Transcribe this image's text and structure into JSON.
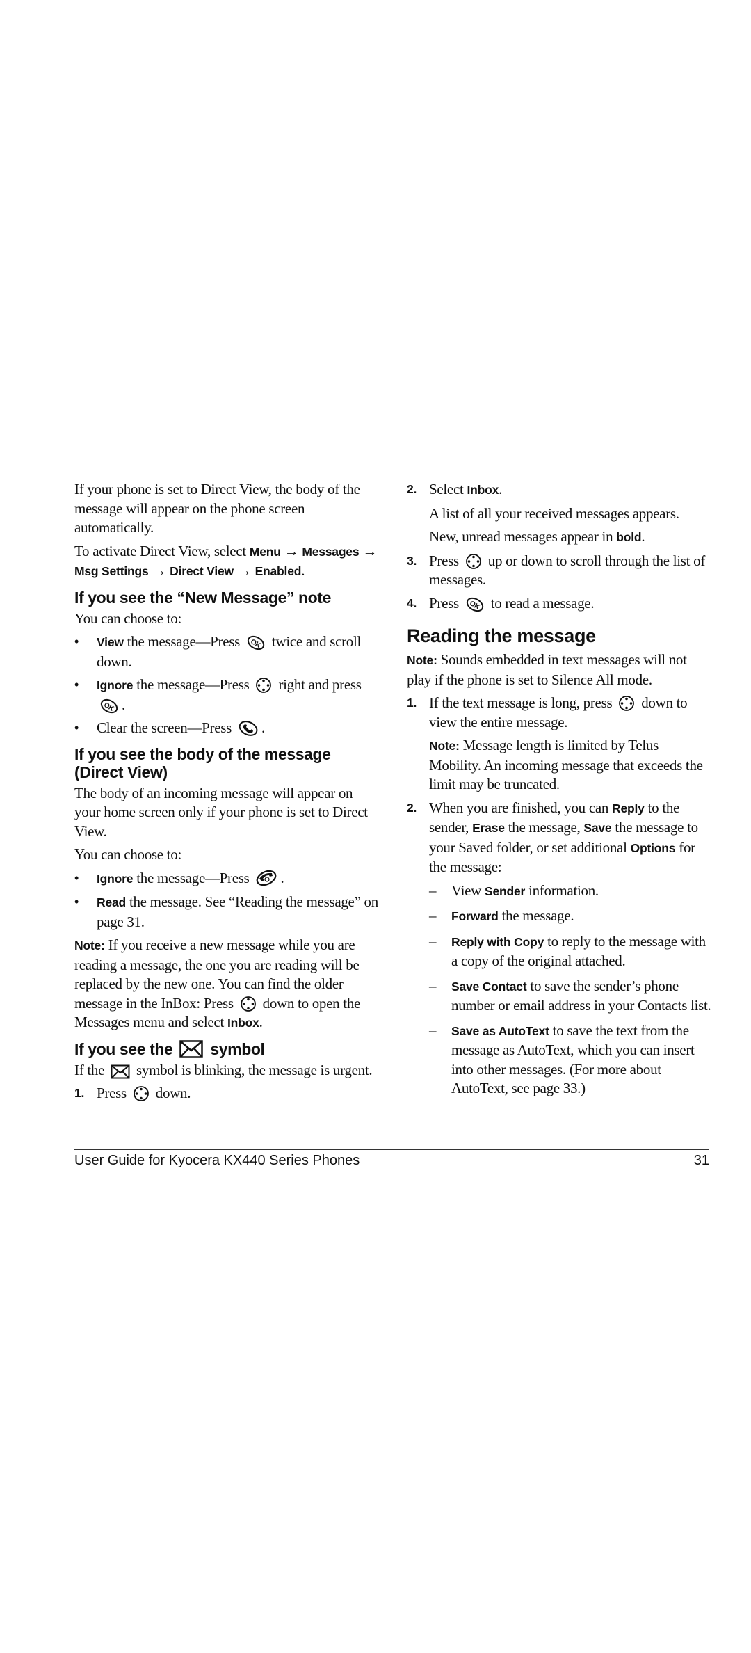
{
  "left": {
    "intro_p1": "If your phone is set to Direct View, the body of the message will appear on the phone screen automatically.",
    "intro_p2_prefix": "To activate Direct View, select",
    "intro_path": [
      "Menu",
      "Messages",
      "Msg Settings",
      "Direct View",
      "Enabled"
    ],
    "arrow": "→",
    "section1": {
      "heading": "If you see the “New Message” note",
      "lead": "You can choose to:",
      "bullets": [
        {
          "bold": "View",
          "text_before_icon": " the message—Press",
          "icon": "ok-key",
          "text_after_icon": "twice and scroll down."
        },
        {
          "bold": "Ignore",
          "text_before_icon": " the message—Press",
          "icon": "nav-key",
          "text_mid": "right and press",
          "icon2": "ok-key",
          "text_after_icon": "."
        },
        {
          "bold": "",
          "text_before_icon": "Clear the screen—Press",
          "icon": "send-key",
          "text_after_icon": "."
        }
      ]
    },
    "section2": {
      "heading": "If you see the body of the message (Direct View)",
      "body": "The body of an incoming message will appear on your home screen only if your phone is set to Direct View.",
      "lead": "You can choose to:",
      "bullets": [
        {
          "bold": "Ignore",
          "text_before_icon": " the message—Press",
          "icon": "end-key",
          "text_after_icon": "."
        },
        {
          "bold": "Read",
          "text": " the message. See “Reading the message” on page 31."
        }
      ],
      "note_label": "Note:",
      "note_text_1": "If you receive a new message while you are reading a message, the one you are reading will be replaced by the new one. You can find the older message in the InBox: Press",
      "note_text_2": "down to open the Messages menu and select",
      "note_bold_end": "Inbox",
      "note_period": "."
    },
    "section3": {
      "heading_before": "If you see the",
      "heading_after": "symbol",
      "icon": "envelope-icon",
      "body_before": "If the",
      "body_after": "symbol is blinking, the message is urgent.",
      "steps": [
        {
          "n": "1.",
          "before": "Press",
          "icon": "nav-key",
          "after": "down."
        }
      ]
    }
  },
  "right": {
    "steps_top": [
      {
        "n": "2.",
        "before": "Select ",
        "bold": "Inbox",
        "after": "."
      },
      {
        "n": "3.",
        "before": "Press",
        "icon": "nav-key",
        "after": "up or down to scroll through the list of messages."
      },
      {
        "n": "4.",
        "before": "Press",
        "icon": "ok-key",
        "after": "to read a message."
      }
    ],
    "step2_sub1": "A list of all your received messages appears.",
    "step2_sub2_before": "New, unread messages appear in ",
    "step2_sub2_bold": "bold",
    "step2_sub2_after": ".",
    "reading": {
      "heading": "Reading the message",
      "note_label": "Note:",
      "note_text": "Sounds embedded in text messages will not play if the phone is set to Silence All mode.",
      "step1_n": "1.",
      "step1_before": "If the text message is long, press",
      "step1_after": "down to view the entire message.",
      "step1_note_label": "Note:",
      "step1_note_text": "Message length is limited by Telus Mobility. An incoming message that exceeds the limit may be truncated.",
      "step2_n": "2.",
      "step2_parts": [
        {
          "t": "When you are finished, you can ",
          "b": false
        },
        {
          "t": "Reply",
          "b": true
        },
        {
          "t": " to the sender, ",
          "b": false
        },
        {
          "t": "Erase",
          "b": true
        },
        {
          "t": " the message, ",
          "b": false
        },
        {
          "t": "Save",
          "b": true
        },
        {
          "t": " the message to your Saved folder, or set additional ",
          "b": false
        },
        {
          "t": "Options",
          "b": true
        },
        {
          "t": " for the message:",
          "b": false
        }
      ],
      "dash": "–",
      "options": [
        {
          "pre": "View ",
          "bold": "Sender",
          "post": " information."
        },
        {
          "pre": "",
          "bold": "Forward",
          "post": " the message."
        },
        {
          "pre": "",
          "bold": "Reply with Copy",
          "post": " to reply to the message with a copy of the original attached."
        },
        {
          "pre": "",
          "bold": "Save Contact",
          "post": " to save the sender’s phone number or email address in your Contacts list."
        },
        {
          "pre": "",
          "bold": "Save as AutoText",
          "post": " to save the text from the message as AutoText, which you can insert into other messages. (For more about AutoText, see page 33.)"
        }
      ]
    }
  },
  "footer": {
    "title": "User Guide for Kyocera KX440 Series Phones",
    "page_number": "31"
  },
  "bullet_glyph": "•"
}
